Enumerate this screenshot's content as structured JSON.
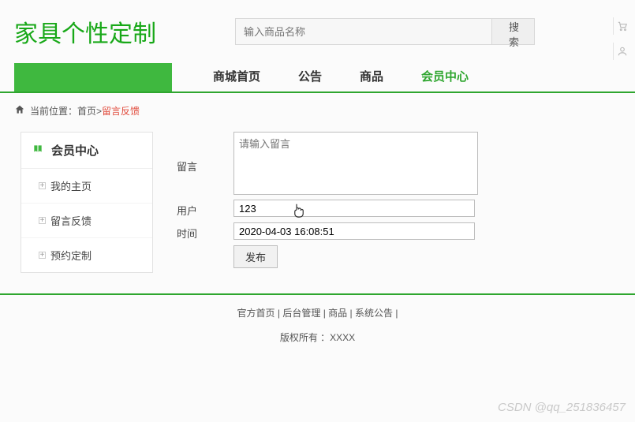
{
  "header": {
    "logo": "家具个性定制",
    "search_placeholder": "输入商品名称",
    "search_btn": "搜 索"
  },
  "nav": {
    "items": [
      {
        "label": "商城首页"
      },
      {
        "label": "公告"
      },
      {
        "label": "商品"
      },
      {
        "label": "会员中心"
      }
    ]
  },
  "breadcrumb": {
    "prefix": "当前位置：",
    "home": "首页",
    "sep": " > ",
    "current": "留言反馈"
  },
  "sidebar": {
    "title": "会员中心",
    "items": [
      {
        "label": "我的主页"
      },
      {
        "label": "留言反馈"
      },
      {
        "label": "预约定制"
      }
    ]
  },
  "form": {
    "msg_label": "留言",
    "msg_placeholder": "请输入留言",
    "user_label": "用户",
    "user_value": "123",
    "time_label": "时间",
    "time_value": "2020-04-03 16:08:51",
    "submit": "发布"
  },
  "footer": {
    "links": [
      "官方首页",
      "后台管理",
      "商品",
      "系统公告"
    ],
    "sep": " | ",
    "copyright": "版权所有 ：XXXX"
  },
  "watermark": "CSDN @qq_251836457"
}
